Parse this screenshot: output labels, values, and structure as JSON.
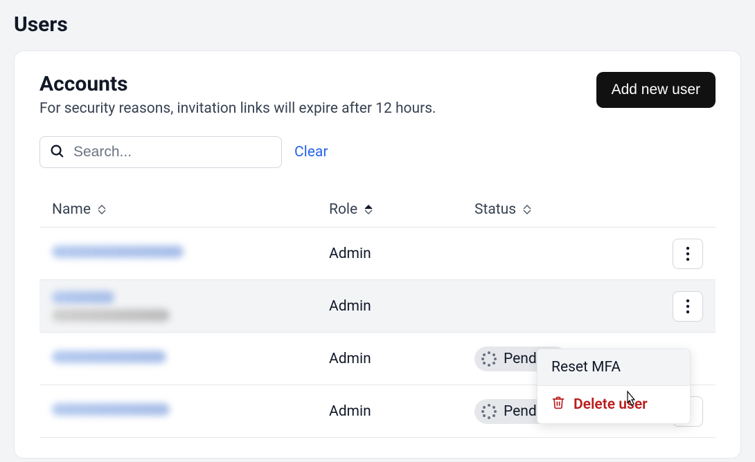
{
  "page": {
    "title": "Users"
  },
  "card": {
    "title": "Accounts",
    "subtitle": "For security reasons, invitation links will expire after 12 hours.",
    "add_button": "Add new user"
  },
  "search": {
    "placeholder": "Search...",
    "clear_label": "Clear"
  },
  "columns": {
    "name": "Name",
    "role": "Role",
    "status": "Status"
  },
  "rows": [
    {
      "role": "Admin",
      "status": ""
    },
    {
      "role": "Admin",
      "status": ""
    },
    {
      "role": "Admin",
      "status": "Pending"
    },
    {
      "role": "Admin",
      "status": "Pending"
    }
  ],
  "menu": {
    "reset_mfa": "Reset MFA",
    "delete_user": "Delete user"
  }
}
